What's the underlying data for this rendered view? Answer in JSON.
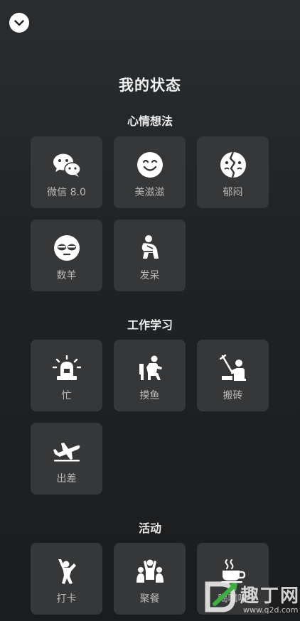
{
  "title": "我的状态",
  "sections": [
    {
      "title": "心情想法",
      "items": [
        {
          "label": "微信 8.0",
          "icon": "wechat-icon"
        },
        {
          "label": "美滋滋",
          "icon": "smile-icon"
        },
        {
          "label": "郁闷",
          "icon": "broken-face-icon"
        },
        {
          "label": "数羊",
          "icon": "sleepy-face-icon"
        },
        {
          "label": "发呆",
          "icon": "thinker-icon"
        }
      ]
    },
    {
      "title": "工作学习",
      "items": [
        {
          "label": "忙",
          "icon": "alarm-icon"
        },
        {
          "label": "摸鱼",
          "icon": "sitting-person-icon"
        },
        {
          "label": "搬砖",
          "icon": "digging-person-icon"
        },
        {
          "label": "出差",
          "icon": "airplane-icon"
        }
      ]
    },
    {
      "title": "活动",
      "items": [
        {
          "label": "打卡",
          "icon": "cheer-person-icon"
        },
        {
          "label": "聚餐",
          "icon": "group-icon"
        },
        {
          "label": "喝咖啡",
          "icon": "coffee-icon"
        }
      ]
    }
  ],
  "watermark": {
    "text": "趣丁网",
    "url": "www.q2d.com"
  }
}
